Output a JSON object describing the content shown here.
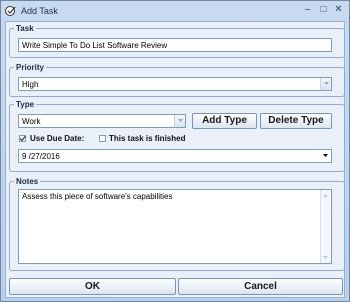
{
  "window": {
    "title": "Add Task"
  },
  "task": {
    "legend": "Task",
    "value": "Write Simple To Do List Software Review"
  },
  "priority": {
    "legend": "Priority",
    "value": "High"
  },
  "type": {
    "legend": "Type",
    "value": "Work",
    "add_type_label": "Add Type",
    "delete_type_label": "Delete Type",
    "use_due_date_label": "Use Due Date:",
    "use_due_date_checked": true,
    "task_finished_label": "This task is finished",
    "task_finished_checked": false,
    "due_date": "9 /27/2016"
  },
  "notes": {
    "legend": "Notes",
    "value": "Assess this piece of software's capabilities"
  },
  "buttons": {
    "ok": "OK",
    "cancel": "Cancel"
  }
}
